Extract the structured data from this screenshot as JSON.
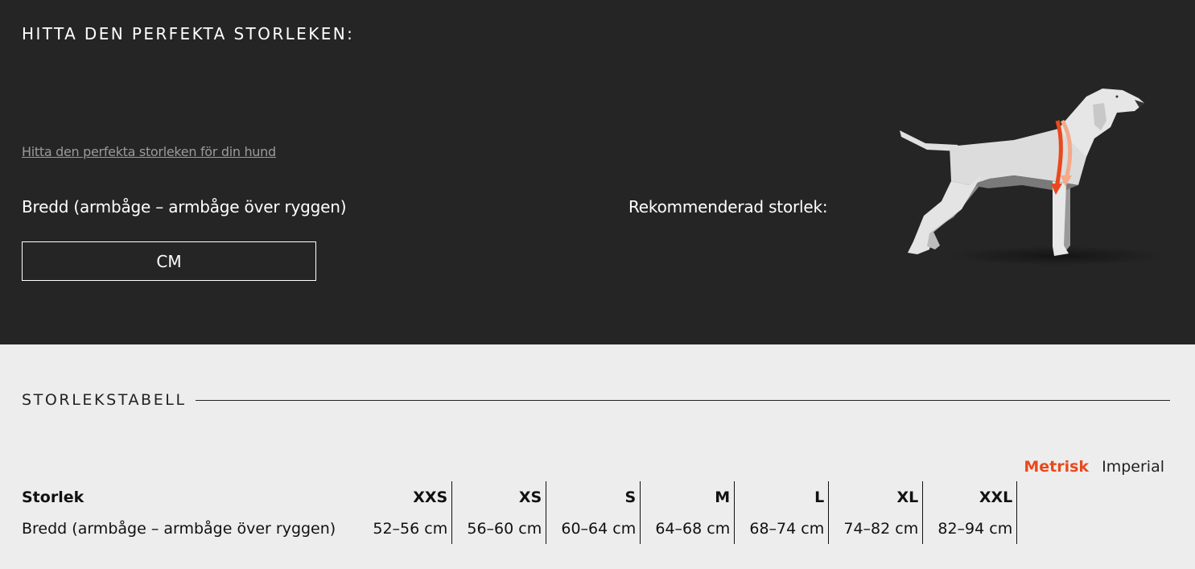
{
  "finder": {
    "title": "HITTA DEN PERFEKTA STORLEKEN:",
    "link": "Hitta den perfekta storleken för din hund",
    "measure_label": "Bredd (armbåge – armbåge över ryggen)",
    "input_placeholder": "CM",
    "recommended_label": "Rekommenderad storlek:"
  },
  "size_table": {
    "title": "STORLEKSTABELL",
    "units": {
      "metric": "Metrisk",
      "imperial": "Imperial",
      "selected": "metric"
    },
    "header_label": "Storlek",
    "sizes": [
      "XXS",
      "XS",
      "S",
      "M",
      "L",
      "XL",
      "XXL"
    ],
    "row_label": "Bredd (armbåge – armbåge över ryggen)",
    "values": [
      "52–56 cm",
      "56–60 cm",
      "60–64 cm",
      "64–68 cm",
      "68–74 cm",
      "74–82 cm",
      "82–94 cm"
    ]
  },
  "colors": {
    "accent": "#e8491d",
    "dark_bg": "#252525",
    "light_bg": "#ededed"
  }
}
